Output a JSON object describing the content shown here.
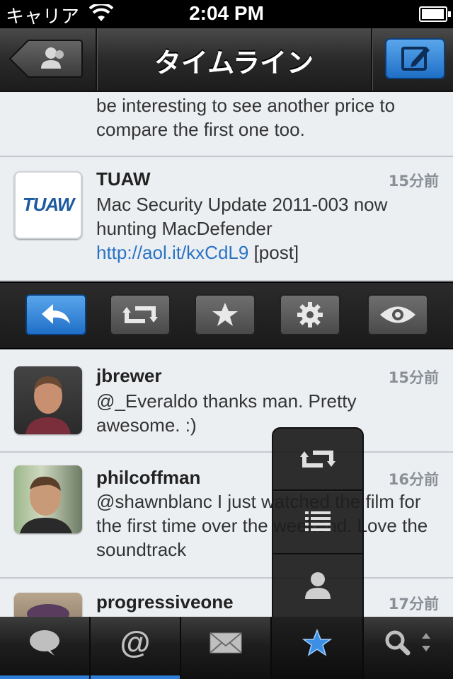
{
  "status_bar": {
    "carrier": "キャリア",
    "time": "2:04 PM"
  },
  "nav_bar": {
    "title": "タイムライン"
  },
  "tweets": [
    {
      "text_lines": [
        "be interesting to see another price to",
        "compare the first one too."
      ]
    },
    {
      "name": "TUAW",
      "time": "15分前",
      "avatar_text": "TUAW",
      "text_part1": "Mac Security Update 2011-003 now hunting MacDefender ",
      "link": "http://aol.it/kxCdL9",
      "text_part2": " [post]"
    },
    {
      "name": "jbrewer",
      "time": "15分前",
      "text": "@_Everaldo thanks man. Pretty awesome. :)"
    },
    {
      "name": "philcoffman",
      "time": "16分前",
      "text": "@shawnblanc I just watched the film for the first time over the weekend. Love the soundtrack"
    },
    {
      "name": "progressiveone",
      "time": "17分前"
    }
  ],
  "action_bar": {
    "buttons": [
      "reply-icon",
      "retweet-icon",
      "star-icon",
      "gear-icon",
      "eye-icon"
    ],
    "active": "reply-icon"
  },
  "popup_menu": {
    "items": [
      "retweet-icon",
      "list-icon",
      "person-icon"
    ]
  },
  "tab_bar": {
    "tabs": [
      "speech-bubble-icon",
      "at-sign-icon",
      "envelope-icon",
      "star-icon",
      "search-icon"
    ],
    "active": "star-icon"
  },
  "colors": {
    "accent_blue": "#2f7ed8",
    "link": "#2a73c4",
    "bar_dark": "#1c1c1c"
  }
}
